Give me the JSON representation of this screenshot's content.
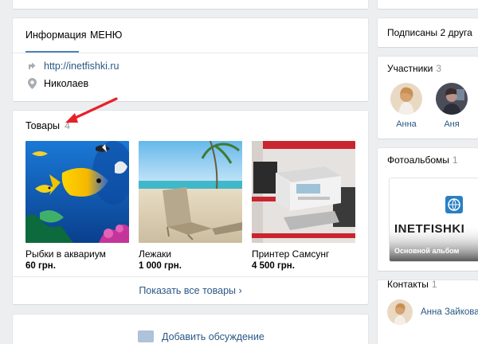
{
  "tabs": {
    "info": "Информация",
    "menu": "МЕНЮ"
  },
  "info": {
    "site": "http://inetfishki.ru",
    "city": "Николаев"
  },
  "goods": {
    "title": "Товары",
    "count": "4",
    "items": [
      {
        "name": "Рыбки в аквариум",
        "price": "60 грн."
      },
      {
        "name": "Лежаки",
        "price": "1 000 грн."
      },
      {
        "name": "Принтер Самсунг",
        "price": "4 500 грн."
      }
    ],
    "show_all": "Показать все товары ›"
  },
  "discussion": {
    "add": "Добавить обсуждение"
  },
  "sidebar": {
    "subscribers": "Подписаны 2 друга",
    "members": {
      "title": "Участники",
      "count": "3",
      "list": [
        {
          "name": "Анна"
        },
        {
          "name": "Аня"
        }
      ]
    },
    "albums": {
      "title": "Фотоальбомы",
      "count": "1",
      "brand": "INETFISHKI",
      "album_name": "Основной альбом"
    },
    "contacts": {
      "title": "Контакты",
      "count": "1",
      "person": "Анна Зайкова"
    }
  },
  "colors": {
    "link": "#2a5885",
    "accent": "#5181b8",
    "annotation": "#e8202a",
    "background": "#edeef0"
  }
}
